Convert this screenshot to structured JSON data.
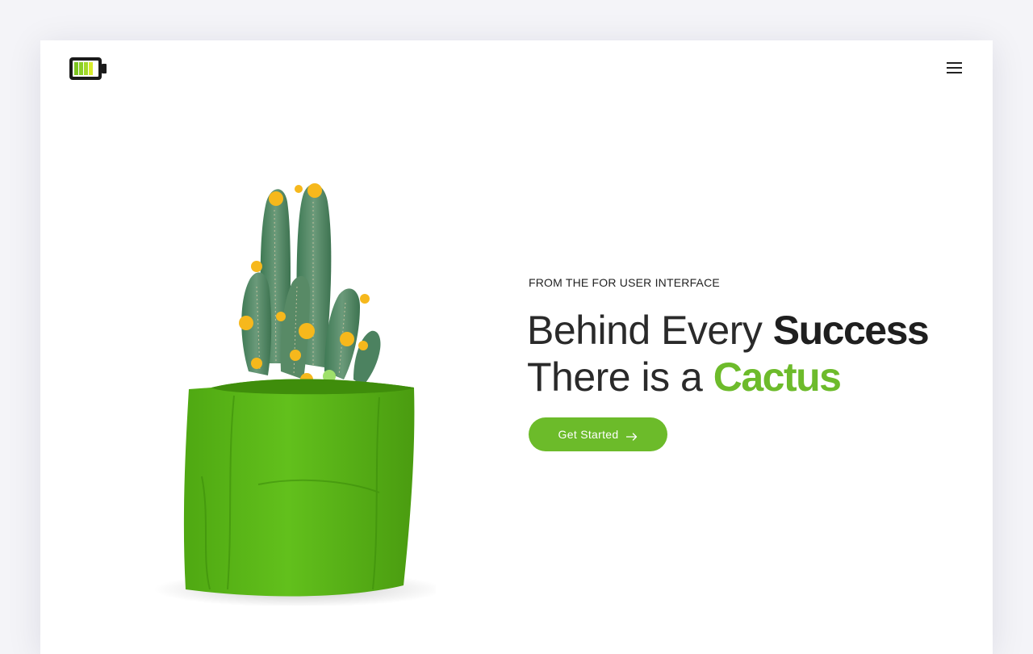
{
  "header": {
    "logo_icon": "battery-icon",
    "menu_icon": "hamburger-menu-icon"
  },
  "hero": {
    "tagline": "FROM THE FOR USER INTERFACE",
    "headline_line1_light": "Behind Every ",
    "headline_line1_bold": "Success",
    "headline_line2_light": "There is a ",
    "headline_line2_accent": "Cactus",
    "cta_label": "Get Started",
    "cta_icon": "arrow-right-icon",
    "image_icon": "potted-cactus-image"
  },
  "colors": {
    "accent": "#6cbb2a",
    "text": "#222222",
    "background": "#f4f4f8"
  }
}
